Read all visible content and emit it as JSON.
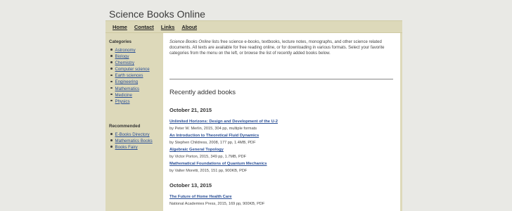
{
  "site": {
    "title": "Science Books Online"
  },
  "nav": {
    "items": [
      "Home",
      "Contact",
      "Links",
      "About"
    ]
  },
  "sidebar": {
    "categories_heading": "Categories",
    "categories": [
      "Astronomy",
      "Biology",
      "Chemistry",
      "Computer science",
      "Earth sciences",
      "Engineering",
      "Mathematics",
      "Medicine",
      "Physics"
    ],
    "recommended_heading": "Recommended",
    "recommended": [
      "E-Books Directory",
      "Mathematics Books",
      "Books Fairy"
    ]
  },
  "intro": {
    "site_name": "Science Books Online",
    "text": " lists free science e-books, textbooks, lecture notes, monographs, and other science related documents. All texts are available for free reading online, or for downloading in various formats. Select your favorite categories from the menu on the left, or browse the list of recently added books below."
  },
  "recent": {
    "heading": "Recently added books",
    "groups": [
      {
        "date": "October 21, 2015",
        "books": [
          {
            "title": "Unlimited Horizons: Design and Development of the U-2",
            "meta": "by Peter W. Merlin, 2015, 304 pp, multiple formats"
          },
          {
            "title": "An Introduction to Theoretical Fluid Dynamics",
            "meta": "by Stephen Childress, 2008, 177 pp, 1.4MB, PDF"
          },
          {
            "title": "Algebraic General Topology",
            "meta": "by Victor Porton, 2015, 349 pp, 1.7MB, PDF"
          },
          {
            "title": "Mathematical Foundations of Quantum Mechanics",
            "meta": "by Valter Moretti, 2015, 151 pp, 900KB, PDF"
          }
        ]
      },
      {
        "date": "October 13, 2015",
        "books": [
          {
            "title": "The Future of Home Health Care",
            "meta": "National Academies Press, 2015, 169 pp, 900KB, PDF"
          }
        ]
      }
    ]
  }
}
